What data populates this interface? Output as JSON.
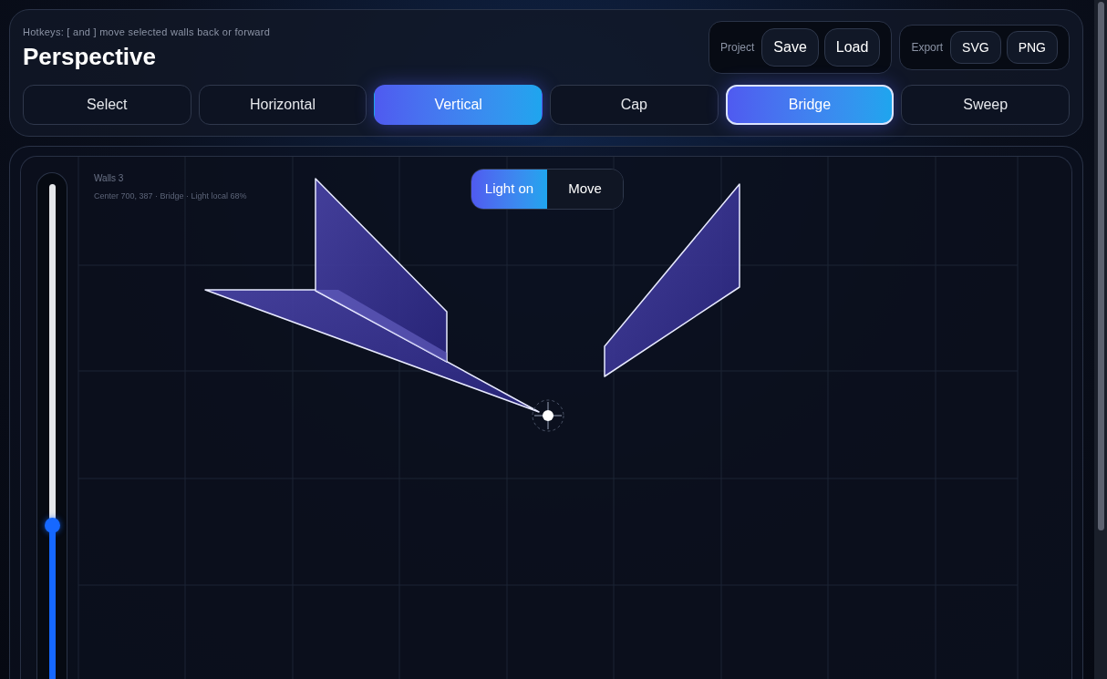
{
  "hint": "Hotkeys: [ and ] move selected walls back or forward",
  "title": "Perspective",
  "project": {
    "label": "Project",
    "buttons": [
      "Save",
      "Load"
    ]
  },
  "export": {
    "label": "Export",
    "buttons": [
      "SVG",
      "PNG"
    ]
  },
  "modes": [
    {
      "label": "Select",
      "selected": false,
      "focused": false
    },
    {
      "label": "Horizontal",
      "selected": false,
      "focused": false
    },
    {
      "label": "Vertical",
      "selected": true,
      "focused": false
    },
    {
      "label": "Cap",
      "selected": false,
      "focused": false
    },
    {
      "label": "Bridge",
      "selected": true,
      "focused": true
    },
    {
      "label": "Sweep",
      "selected": false,
      "focused": false
    }
  ],
  "canvas": {
    "walls_label": "Walls 3",
    "info": "Center 700, 387 · Bridge · Light local 68%",
    "light_toggle": [
      {
        "label": "Light on",
        "selected": true
      },
      {
        "label": "Move",
        "selected": false
      }
    ],
    "slider": {
      "level": 0.31
    }
  }
}
